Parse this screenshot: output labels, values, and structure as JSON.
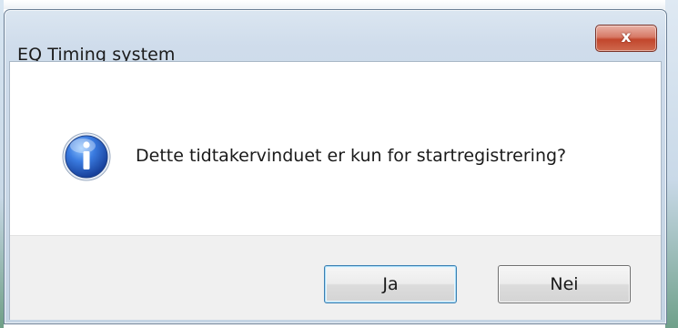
{
  "window": {
    "title": "EQ Timing system",
    "close_label": "x"
  },
  "dialog": {
    "icon": "information-icon",
    "message": "Dette tidtakervinduet er kun for startregistrering?"
  },
  "buttons": {
    "yes_label": "Ja",
    "no_label": "Nei"
  },
  "colors": {
    "titlebar": "#cfdceb",
    "close_button": "#c2462c",
    "button_area": "#f0f0f0",
    "info_icon": "#2a62b8"
  }
}
